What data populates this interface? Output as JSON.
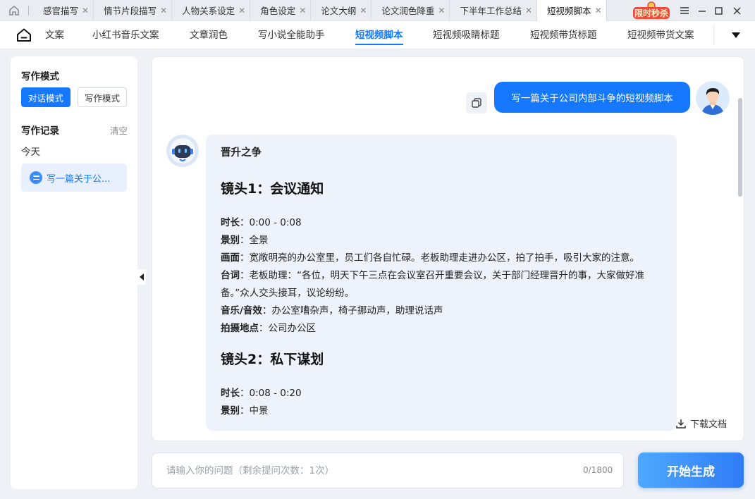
{
  "tabs": [
    {
      "label": "感官描写"
    },
    {
      "label": "情节片段描写"
    },
    {
      "label": "人物关系设定"
    },
    {
      "label": "角色设定"
    },
    {
      "label": "论文大纲"
    },
    {
      "label": "论文润色降重"
    },
    {
      "label": "下半年工作总结"
    },
    {
      "label": "短视频脚本",
      "active": true
    }
  ],
  "promo_badge": "限时秒杀",
  "nav": {
    "items": [
      "文案",
      "小红书音乐文案",
      "文章润色",
      "写小说全能助手",
      "短视频脚本",
      "短视频吸睛标题",
      "短视频带货标题",
      "短视频带货文案"
    ],
    "active": "短视频脚本"
  },
  "sidebar": {
    "mode_title": "写作模式",
    "mode_chat": "对话模式",
    "mode_write": "写作模式",
    "history_title": "写作记录",
    "clear": "清空",
    "today": "今天",
    "history_item": "写一篇关于公..."
  },
  "chat": {
    "user_message": "写一篇关于公司内部斗争的短视频脚本",
    "answer_title": "晋升之争",
    "shot1": {
      "title": "镜头1：会议通知",
      "duration_label": "时长",
      "duration": "：0:00 - 0:08",
      "scene_label": "景别",
      "scene": "：全景",
      "visual_label": "画面",
      "visual": "：宽敞明亮的办公室里，员工们各自忙碌。老板助理走进办公区，拍了拍手，吸引大家的注意。",
      "lines_label": "台词",
      "lines": "：老板助理：“各位，明天下午三点在会议室召开重要会议，关于部门经理晋升的事，大家做好准备。”众人交头接耳，议论纷纷。",
      "sound_label": "音乐/音效",
      "sound": "：办公室嘈杂声，椅子挪动声，助理说话声",
      "location_label": "拍摄地点",
      "location": "：公司办公区"
    },
    "shot2": {
      "title": "镜头2：私下谋划",
      "duration_label": "时长",
      "duration": "：0:08 - 0:20",
      "scene_label": "景别",
      "scene": "：中景"
    },
    "download": "下载文档"
  },
  "input": {
    "placeholder": "请输入你的问题（剩余提问次数：1次）",
    "count": "0/1800",
    "generate": "开始生成"
  }
}
